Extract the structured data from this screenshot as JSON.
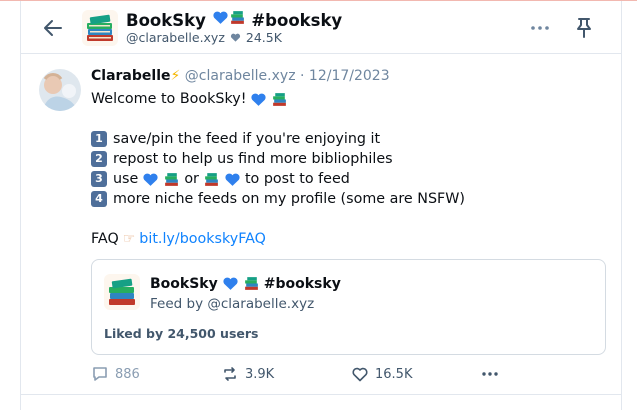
{
  "feed": {
    "title": "BookSky 💙📚 #booksky",
    "title_text": "BookSky",
    "title_tag": "#booksky",
    "creator_handle": "@clarabelle.xyz",
    "like_count": "24.5K"
  },
  "post": {
    "author_name": "Clarabelle",
    "author_handle": "@clarabelle.xyz",
    "separator": "·",
    "date": "12/17/2023",
    "lines": {
      "welcome": "Welcome to BookSky!",
      "item1": "save/pin the feed if you're enjoying it",
      "item2": "repost to help us find more bibliophiles",
      "item3_a": "use",
      "item3_b": "or",
      "item3_c": "to post to feed",
      "item4": "more niche feeds on my profile (some are NSFW)",
      "faq_label": "FAQ",
      "faq_link": "bit.ly/bookskyFAQ"
    },
    "embed": {
      "title_text": "BookSky",
      "title_tag": "#booksky",
      "subtitle": "Feed by @clarabelle.xyz",
      "liked_by": "Liked by 24,500 users"
    },
    "stats": {
      "replies": "886",
      "reposts": "3.9K",
      "likes": "16.5K"
    }
  },
  "colors": {
    "accent": "#1083fe",
    "muted": "#6f869f",
    "border": "#e2e7ee"
  },
  "icons": {
    "back": "arrow-left-icon",
    "more": "ellipsis-icon",
    "pin": "pin-icon",
    "reply": "speech-bubble-icon",
    "repost": "repost-icon",
    "like": "heart-icon"
  }
}
